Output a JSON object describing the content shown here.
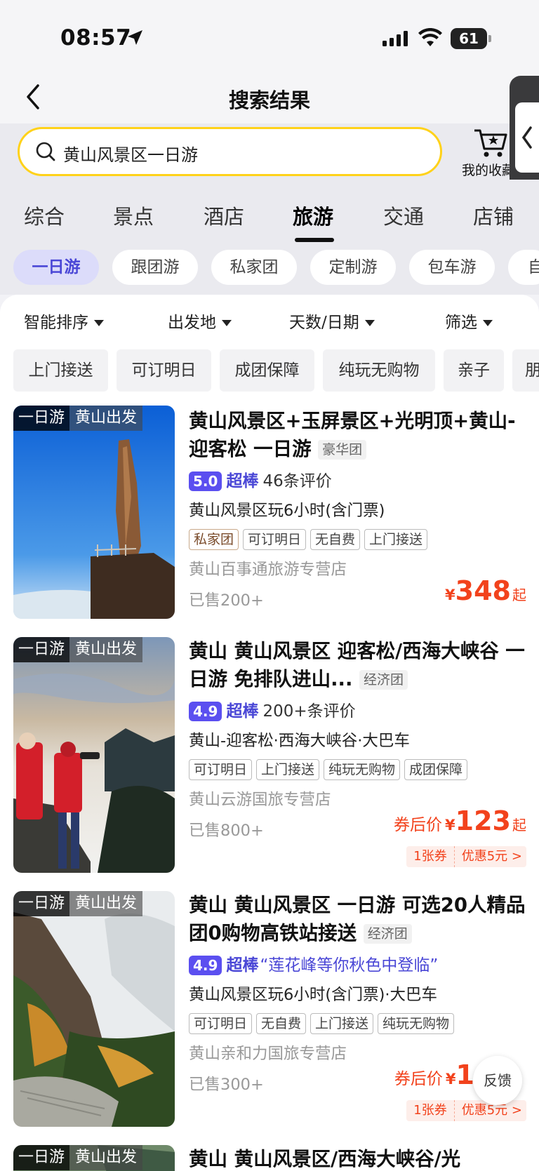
{
  "status_bar": {
    "time": "08:57",
    "battery": "61"
  },
  "header": {
    "title": "搜索结果",
    "back_icon": "chevron-left-icon"
  },
  "search": {
    "query": "黄山风景区一日游",
    "favorites_label": "我的收藏"
  },
  "category_tabs": [
    "综合",
    "景点",
    "酒店",
    "旅游",
    "交通",
    "店铺"
  ],
  "active_tab": "旅游",
  "sub_chips": [
    "一日游",
    "跟团游",
    "私家团",
    "定制游",
    "包车游",
    "自"
  ],
  "active_chip": "一日游",
  "sort_bar": [
    "智能排序",
    "出发地",
    "天数/日期",
    "筛选"
  ],
  "quick_filters": [
    "上门接送",
    "可订明日",
    "成团保障",
    "纯玩无购物",
    "亲子",
    "朋"
  ],
  "products": [
    {
      "badge_type": "一日游",
      "badge_origin": "黄山出发",
      "title": "黄山风景区+玉屏景区+光明顶+黄山-迎客松 一日游",
      "grade": "豪华团",
      "score": "5.0",
      "level": "超棒",
      "reviews": "46条评价",
      "quote": "",
      "subtitle": "黄山风景区玩6小时(含门票)",
      "tags": [
        "私家团",
        "可订明日",
        "无自费",
        "上门接送"
      ],
      "shop": "黄山百事通旅游专营店",
      "sold": "已售200+",
      "price_prefix": "",
      "currency": "¥",
      "price": "348",
      "price_suffix": "起",
      "coupon_count": "",
      "coupon_text": ""
    },
    {
      "badge_type": "一日游",
      "badge_origin": "黄山出发",
      "title": "黄山  黄山风景区 迎客松/西海大峡谷 一日游 免排队进山...",
      "grade": "经济团",
      "score": "4.9",
      "level": "超棒",
      "reviews": "200+条评价",
      "quote": "",
      "subtitle": "黄山-迎客松·西海大峡谷·大巴车",
      "tags": [
        "可订明日",
        "上门接送",
        "纯玩无购物",
        "成团保障"
      ],
      "shop": "黄山云游国旅专营店",
      "sold": "已售800+",
      "price_prefix": "券后价",
      "currency": "¥",
      "price": "123",
      "price_suffix": "起",
      "coupon_count": "1张券",
      "coupon_text": "优惠5元 >"
    },
    {
      "badge_type": "一日游",
      "badge_origin": "黄山出发",
      "title": "黄山  黄山风景区 一日游 可选20人精品团0购物高铁站接送",
      "grade": "经济团",
      "score": "4.9",
      "level": "超棒",
      "reviews": "",
      "quote": "“莲花峰等你秋色中登临”",
      "subtitle": "黄山风景区玩6小时(含门票)·大巴车",
      "tags": [
        "可订明日",
        "无自费",
        "上门接送",
        "纯玩无购物"
      ],
      "shop": "黄山亲和力国旅专营店",
      "sold": "已售300+",
      "price_prefix": "券后价",
      "currency": "¥",
      "price": "1",
      "price_suffix": "",
      "coupon_count": "1张券",
      "coupon_text": "优惠5元 >"
    },
    {
      "badge_type": "一日游",
      "badge_origin": "黄山出发",
      "title": "黄山  黄山风景区/西海大峡谷/光",
      "grade": ""
    }
  ],
  "feedback_label": "反馈",
  "colors": {
    "accent": "#4a47d6",
    "price": "#f2421c",
    "search_border": "#ffd21a"
  }
}
